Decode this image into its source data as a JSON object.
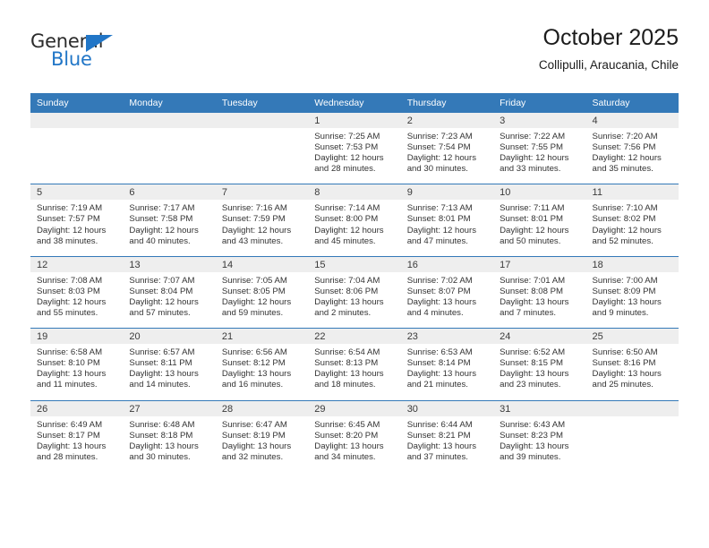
{
  "brand": {
    "word_general": "General",
    "word_blue": "Blue",
    "flag_color": "#2176c7"
  },
  "header": {
    "title": "October 2025",
    "subtitle": "Collipulli, Araucania, Chile"
  },
  "theme": {
    "header_blue": "#3479b8",
    "daynum_gray": "#eeeeee",
    "text": "#333333"
  },
  "weekday_headers": [
    "Sunday",
    "Monday",
    "Tuesday",
    "Wednesday",
    "Thursday",
    "Friday",
    "Saturday"
  ],
  "weeks": [
    [
      {
        "day": "",
        "empty": true,
        "sunrise": "",
        "sunset": "",
        "daylight_1": "",
        "daylight_2": ""
      },
      {
        "day": "",
        "empty": true,
        "sunrise": "",
        "sunset": "",
        "daylight_1": "",
        "daylight_2": ""
      },
      {
        "day": "",
        "empty": true,
        "sunrise": "",
        "sunset": "",
        "daylight_1": "",
        "daylight_2": ""
      },
      {
        "day": "1",
        "empty": false,
        "sunrise": "Sunrise: 7:25 AM",
        "sunset": "Sunset: 7:53 PM",
        "daylight_1": "Daylight: 12 hours",
        "daylight_2": "and 28 minutes."
      },
      {
        "day": "2",
        "empty": false,
        "sunrise": "Sunrise: 7:23 AM",
        "sunset": "Sunset: 7:54 PM",
        "daylight_1": "Daylight: 12 hours",
        "daylight_2": "and 30 minutes."
      },
      {
        "day": "3",
        "empty": false,
        "sunrise": "Sunrise: 7:22 AM",
        "sunset": "Sunset: 7:55 PM",
        "daylight_1": "Daylight: 12 hours",
        "daylight_2": "and 33 minutes."
      },
      {
        "day": "4",
        "empty": false,
        "sunrise": "Sunrise: 7:20 AM",
        "sunset": "Sunset: 7:56 PM",
        "daylight_1": "Daylight: 12 hours",
        "daylight_2": "and 35 minutes."
      }
    ],
    [
      {
        "day": "5",
        "empty": false,
        "sunrise": "Sunrise: 7:19 AM",
        "sunset": "Sunset: 7:57 PM",
        "daylight_1": "Daylight: 12 hours",
        "daylight_2": "and 38 minutes."
      },
      {
        "day": "6",
        "empty": false,
        "sunrise": "Sunrise: 7:17 AM",
        "sunset": "Sunset: 7:58 PM",
        "daylight_1": "Daylight: 12 hours",
        "daylight_2": "and 40 minutes."
      },
      {
        "day": "7",
        "empty": false,
        "sunrise": "Sunrise: 7:16 AM",
        "sunset": "Sunset: 7:59 PM",
        "daylight_1": "Daylight: 12 hours",
        "daylight_2": "and 43 minutes."
      },
      {
        "day": "8",
        "empty": false,
        "sunrise": "Sunrise: 7:14 AM",
        "sunset": "Sunset: 8:00 PM",
        "daylight_1": "Daylight: 12 hours",
        "daylight_2": "and 45 minutes."
      },
      {
        "day": "9",
        "empty": false,
        "sunrise": "Sunrise: 7:13 AM",
        "sunset": "Sunset: 8:01 PM",
        "daylight_1": "Daylight: 12 hours",
        "daylight_2": "and 47 minutes."
      },
      {
        "day": "10",
        "empty": false,
        "sunrise": "Sunrise: 7:11 AM",
        "sunset": "Sunset: 8:01 PM",
        "daylight_1": "Daylight: 12 hours",
        "daylight_2": "and 50 minutes."
      },
      {
        "day": "11",
        "empty": false,
        "sunrise": "Sunrise: 7:10 AM",
        "sunset": "Sunset: 8:02 PM",
        "daylight_1": "Daylight: 12 hours",
        "daylight_2": "and 52 minutes."
      }
    ],
    [
      {
        "day": "12",
        "empty": false,
        "sunrise": "Sunrise: 7:08 AM",
        "sunset": "Sunset: 8:03 PM",
        "daylight_1": "Daylight: 12 hours",
        "daylight_2": "and 55 minutes."
      },
      {
        "day": "13",
        "empty": false,
        "sunrise": "Sunrise: 7:07 AM",
        "sunset": "Sunset: 8:04 PM",
        "daylight_1": "Daylight: 12 hours",
        "daylight_2": "and 57 minutes."
      },
      {
        "day": "14",
        "empty": false,
        "sunrise": "Sunrise: 7:05 AM",
        "sunset": "Sunset: 8:05 PM",
        "daylight_1": "Daylight: 12 hours",
        "daylight_2": "and 59 minutes."
      },
      {
        "day": "15",
        "empty": false,
        "sunrise": "Sunrise: 7:04 AM",
        "sunset": "Sunset: 8:06 PM",
        "daylight_1": "Daylight: 13 hours",
        "daylight_2": "and 2 minutes."
      },
      {
        "day": "16",
        "empty": false,
        "sunrise": "Sunrise: 7:02 AM",
        "sunset": "Sunset: 8:07 PM",
        "daylight_1": "Daylight: 13 hours",
        "daylight_2": "and 4 minutes."
      },
      {
        "day": "17",
        "empty": false,
        "sunrise": "Sunrise: 7:01 AM",
        "sunset": "Sunset: 8:08 PM",
        "daylight_1": "Daylight: 13 hours",
        "daylight_2": "and 7 minutes."
      },
      {
        "day": "18",
        "empty": false,
        "sunrise": "Sunrise: 7:00 AM",
        "sunset": "Sunset: 8:09 PM",
        "daylight_1": "Daylight: 13 hours",
        "daylight_2": "and 9 minutes."
      }
    ],
    [
      {
        "day": "19",
        "empty": false,
        "sunrise": "Sunrise: 6:58 AM",
        "sunset": "Sunset: 8:10 PM",
        "daylight_1": "Daylight: 13 hours",
        "daylight_2": "and 11 minutes."
      },
      {
        "day": "20",
        "empty": false,
        "sunrise": "Sunrise: 6:57 AM",
        "sunset": "Sunset: 8:11 PM",
        "daylight_1": "Daylight: 13 hours",
        "daylight_2": "and 14 minutes."
      },
      {
        "day": "21",
        "empty": false,
        "sunrise": "Sunrise: 6:56 AM",
        "sunset": "Sunset: 8:12 PM",
        "daylight_1": "Daylight: 13 hours",
        "daylight_2": "and 16 minutes."
      },
      {
        "day": "22",
        "empty": false,
        "sunrise": "Sunrise: 6:54 AM",
        "sunset": "Sunset: 8:13 PM",
        "daylight_1": "Daylight: 13 hours",
        "daylight_2": "and 18 minutes."
      },
      {
        "day": "23",
        "empty": false,
        "sunrise": "Sunrise: 6:53 AM",
        "sunset": "Sunset: 8:14 PM",
        "daylight_1": "Daylight: 13 hours",
        "daylight_2": "and 21 minutes."
      },
      {
        "day": "24",
        "empty": false,
        "sunrise": "Sunrise: 6:52 AM",
        "sunset": "Sunset: 8:15 PM",
        "daylight_1": "Daylight: 13 hours",
        "daylight_2": "and 23 minutes."
      },
      {
        "day": "25",
        "empty": false,
        "sunrise": "Sunrise: 6:50 AM",
        "sunset": "Sunset: 8:16 PM",
        "daylight_1": "Daylight: 13 hours",
        "daylight_2": "and 25 minutes."
      }
    ],
    [
      {
        "day": "26",
        "empty": false,
        "sunrise": "Sunrise: 6:49 AM",
        "sunset": "Sunset: 8:17 PM",
        "daylight_1": "Daylight: 13 hours",
        "daylight_2": "and 28 minutes."
      },
      {
        "day": "27",
        "empty": false,
        "sunrise": "Sunrise: 6:48 AM",
        "sunset": "Sunset: 8:18 PM",
        "daylight_1": "Daylight: 13 hours",
        "daylight_2": "and 30 minutes."
      },
      {
        "day": "28",
        "empty": false,
        "sunrise": "Sunrise: 6:47 AM",
        "sunset": "Sunset: 8:19 PM",
        "daylight_1": "Daylight: 13 hours",
        "daylight_2": "and 32 minutes."
      },
      {
        "day": "29",
        "empty": false,
        "sunrise": "Sunrise: 6:45 AM",
        "sunset": "Sunset: 8:20 PM",
        "daylight_1": "Daylight: 13 hours",
        "daylight_2": "and 34 minutes."
      },
      {
        "day": "30",
        "empty": false,
        "sunrise": "Sunrise: 6:44 AM",
        "sunset": "Sunset: 8:21 PM",
        "daylight_1": "Daylight: 13 hours",
        "daylight_2": "and 37 minutes."
      },
      {
        "day": "31",
        "empty": false,
        "sunrise": "Sunrise: 6:43 AM",
        "sunset": "Sunset: 8:23 PM",
        "daylight_1": "Daylight: 13 hours",
        "daylight_2": "and 39 minutes."
      },
      {
        "day": "",
        "empty": true,
        "sunrise": "",
        "sunset": "",
        "daylight_1": "",
        "daylight_2": ""
      }
    ]
  ]
}
